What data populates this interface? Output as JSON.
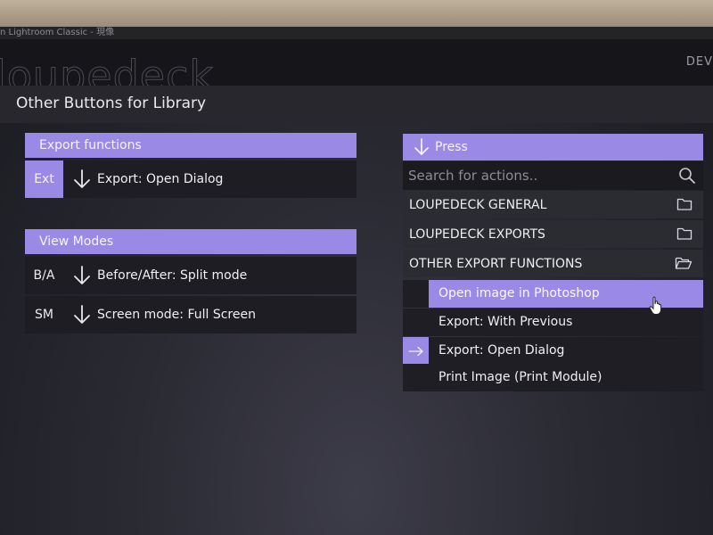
{
  "window": {
    "title_fragment": "n Lightroom Classic - 現像",
    "logo_text": "loupedeck",
    "nav_right": "DEV"
  },
  "page": {
    "title": "Other Buttons for Library"
  },
  "left": {
    "groups": [
      {
        "header": "Export functions",
        "rows": [
          {
            "key": "Ext",
            "active": true,
            "label": "Export: Open Dialog"
          }
        ]
      },
      {
        "header": "View Modes",
        "rows": [
          {
            "key": "B/A",
            "active": false,
            "label": "Before/After: Split mode"
          },
          {
            "key": "SM",
            "active": false,
            "label": "Screen mode: Full Screen"
          }
        ]
      }
    ]
  },
  "right": {
    "header": "Press",
    "search_placeholder": "Search for actions..",
    "groups": [
      {
        "label": "LOUPEDECK GENERAL",
        "icon": "folder-icon"
      },
      {
        "label": "LOUPEDECK EXPORTS",
        "icon": "folder-icon"
      },
      {
        "label": "OTHER EXPORT FUNCTIONS",
        "icon": "folder-open-icon"
      }
    ],
    "actions": [
      {
        "label": "Open image in Photoshop",
        "selected": true
      },
      {
        "label": "Export: With Previous",
        "selected": false
      },
      {
        "label": "Export: Open Dialog",
        "selected": false,
        "assigned": true
      },
      {
        "label": "Print Image (Print Module)",
        "selected": false
      }
    ]
  },
  "colors": {
    "accent": "#9b89e6",
    "row_bg": "#1d1d23",
    "group_bg": "#2b2b32"
  }
}
